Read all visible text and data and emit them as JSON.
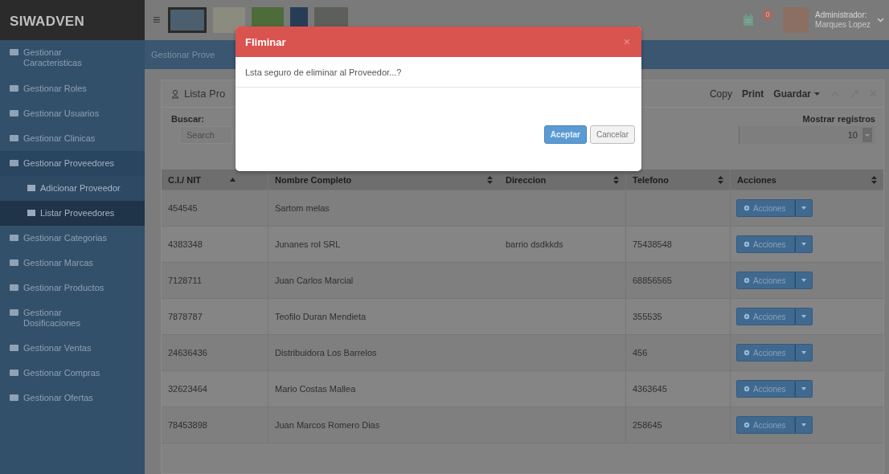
{
  "topbar": {
    "brand": "SIWADVEN",
    "menu_toggle": "≡",
    "notification_count": "0",
    "user_role": "Administrador:",
    "user_name": "Marques Lopez"
  },
  "sidebar": {
    "items": [
      {
        "label": "Gestionar Caracteristicas",
        "selected": false
      },
      {
        "label": "Gestionar Roles",
        "selected": false
      },
      {
        "label": "Gestionar Usuarios",
        "selected": false
      },
      {
        "label": "Gestionar Clinicas",
        "selected": false
      },
      {
        "label": "Gestionar Proveedores",
        "selected": true,
        "children": [
          {
            "label": "Adicionar Proveedor",
            "selected": false
          },
          {
            "label": "Listar Proveedores",
            "selected": true
          }
        ]
      },
      {
        "label": "Gestionar Categorias",
        "selected": false
      },
      {
        "label": "Gestionar Marcas",
        "selected": false
      },
      {
        "label": "Gestionar Productos",
        "selected": false
      },
      {
        "label": "Gestionar Dosificaciones",
        "selected": false
      },
      {
        "label": "Gestionar Ventas",
        "selected": false
      },
      {
        "label": "Gestionar Compras",
        "selected": false
      },
      {
        "label": "Gestionar Ofertas",
        "selected": false
      }
    ]
  },
  "breadcrumb": "Gestionar Prove",
  "panel": {
    "title": "Lista Pro",
    "tools": [
      "Copy",
      "Print",
      "Guardar"
    ],
    "search": {
      "label": "Buscar:",
      "placeholder": "Search"
    },
    "page_size": {
      "label": "Mostrar registros",
      "value": "10"
    },
    "table": {
      "columns": [
        "C.I./ NIT",
        "Nombre Completo",
        "Direccion",
        "Telefono",
        "Acciones"
      ],
      "rows": [
        {
          "ci": "454545",
          "nombre": "Sartom melas",
          "action": "Acciones"
        },
        {
          "ci": "4383348",
          "nombre": "Junanes rol SRL",
          "direccion": "barrio dsdkkds",
          "telefono": "75438548",
          "action": "Acciones"
        },
        {
          "ci": "7128711",
          "nombre": "Juan Carlos Marcial",
          "telefono": "68856565",
          "action": "Acciones"
        },
        {
          "ci": "7878787",
          "nombre": "Teofilo Duran Mendieta",
          "telefono": "355535",
          "action": "Acciones"
        },
        {
          "ci": "24636436",
          "nombre": "Distribuidora Los Barrelos",
          "telefono": "456",
          "action": "Acciones"
        },
        {
          "ci": "32623464",
          "nombre": "Mario Costas Mallea",
          "telefono": "4363645",
          "action": "Acciones"
        },
        {
          "ci": "78453898",
          "nombre": "Juan Marcos Romero Dias",
          "telefono": "258645",
          "action": "Acciones"
        }
      ]
    }
  },
  "modal": {
    "title": "Fliminar",
    "close": "×",
    "message": "Lsta seguro de eliminar al Proveedor...?",
    "buttons": [
      {
        "label": "Aceptar",
        "kind": "primary"
      },
      {
        "label": "Cancelar",
        "kind": "default"
      }
    ]
  }
}
